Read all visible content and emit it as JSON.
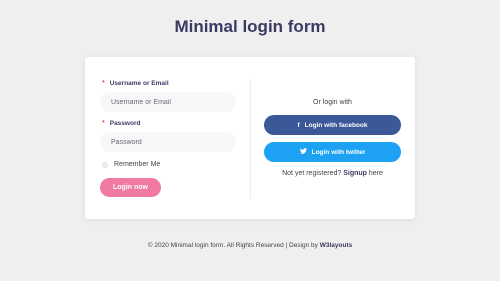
{
  "page": {
    "title": "Minimal login form"
  },
  "form": {
    "username_label": "Username or Email",
    "username_placeholder": "Username or Email",
    "password_label": "Password",
    "password_placeholder": "Password",
    "required_marker": "*",
    "remember_label": "Remember Me",
    "login_label": "Login now"
  },
  "social": {
    "or_text": "Or login with",
    "facebook_icon": "f",
    "facebook_label": "Login with facebook",
    "twitter_icon": "twitter-bird",
    "twitter_label": "Login with twitter",
    "register_prefix": "Not yet registered? ",
    "register_link": "Signup",
    "register_suffix": " here"
  },
  "footer": {
    "text": "© 2020 Minimal login form. All Rights Reserved | Design by ",
    "link": "W3layouts"
  },
  "colors": {
    "title": "#3b3a63",
    "login_button": "#f07aa2",
    "facebook": "#3b5998",
    "twitter": "#1da1f2",
    "required": "#f0487f"
  }
}
